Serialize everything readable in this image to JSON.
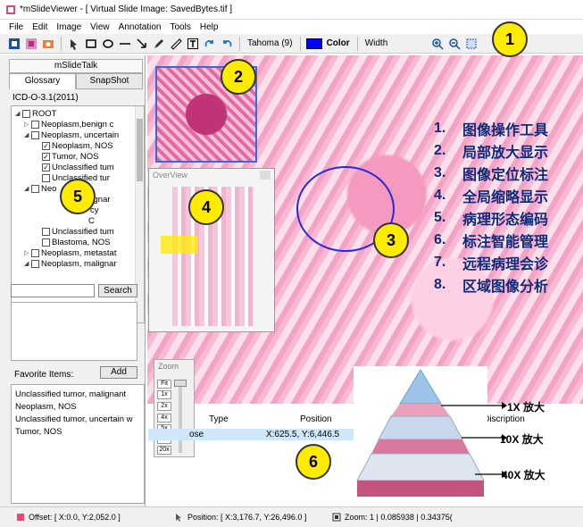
{
  "window": {
    "title": "*mSlideViewer - [ Virtual Slide Image: SavedBytes.tif ]"
  },
  "menu": [
    "File",
    "Edit",
    "Image",
    "View",
    "Annotation",
    "Tools",
    "Help"
  ],
  "toolbar": {
    "font_label": "Tahoma (9)",
    "color_label": "Color",
    "width_label": "Width"
  },
  "left_panel": {
    "title": "mSlideTalk",
    "tabs": [
      "Glossary",
      "SnapShot"
    ],
    "version": "ICD-O-3.1(2011)",
    "tree": [
      {
        "label": "ROOT"
      },
      {
        "label": "Neoplasm,benign c"
      },
      {
        "label": "Neoplasm, uncertain"
      },
      {
        "label": "Neoplasm, NOS"
      },
      {
        "label": "Tumor, NOS"
      },
      {
        "label": "Unclassified tum"
      },
      {
        "label": "Unclassified tur"
      },
      {
        "label": "Neo"
      },
      {
        "label": "alignar"
      },
      {
        "label": "cy"
      },
      {
        "label": "C"
      },
      {
        "label": "Unclassified tum"
      },
      {
        "label": "Blastoma, NOS"
      },
      {
        "label": "Neoplasm, metastat"
      },
      {
        "label": "Neoplasm, malignar"
      }
    ],
    "search_button": "Search",
    "favorites_label": "Favorite Items:",
    "add_button": "Add",
    "favorites": [
      "Unclassified tumor, malignant",
      "Neoplasm, NOS",
      "Unclassified tumor, uncertain w",
      "Tumor, NOS"
    ]
  },
  "overview": {
    "title": "OverView"
  },
  "zoom": {
    "title": "Zoom",
    "levels": [
      "Fit",
      "1x",
      "2x",
      "4x",
      "5x",
      "10x",
      "20x"
    ]
  },
  "annotations": {
    "headers": [
      "Type",
      "Position"
    ],
    "desc_header": "rtDiscription",
    "row": {
      "type": "ose",
      "position": "X:625.5, Y:6,446.5"
    }
  },
  "badges": [
    "1",
    "2",
    "3",
    "4",
    "5",
    "6"
  ],
  "features": [
    {
      "num": "1.",
      "text": "图像操作工具"
    },
    {
      "num": "2.",
      "text": "局部放大显示"
    },
    {
      "num": "3.",
      "text": "图像定位标注"
    },
    {
      "num": "4.",
      "text": "全局缩略显示"
    },
    {
      "num": "5.",
      "text": "病理形态编码"
    },
    {
      "num": "6.",
      "text": "标注智能管理"
    },
    {
      "num": "7.",
      "text": "远程病理会诊"
    },
    {
      "num": "8.",
      "text": "区域图像分析"
    }
  ],
  "pyramid_labels": [
    "1X 放大",
    "10X 放大",
    "40X 放大"
  ],
  "status": {
    "offset": "Offset: [ X:0.0, Y:2,052.0 ]",
    "position": "Position: [ X:3,176.7, Y:26,496.0 ]",
    "zoom": "Zoom: 1 | 0.085938 | 0.34375("
  },
  "colors": {
    "accent": "#0000ff",
    "badge": "#ffeb00",
    "feature_text": "#0d2b7a",
    "selection": "#cfe7fb"
  }
}
